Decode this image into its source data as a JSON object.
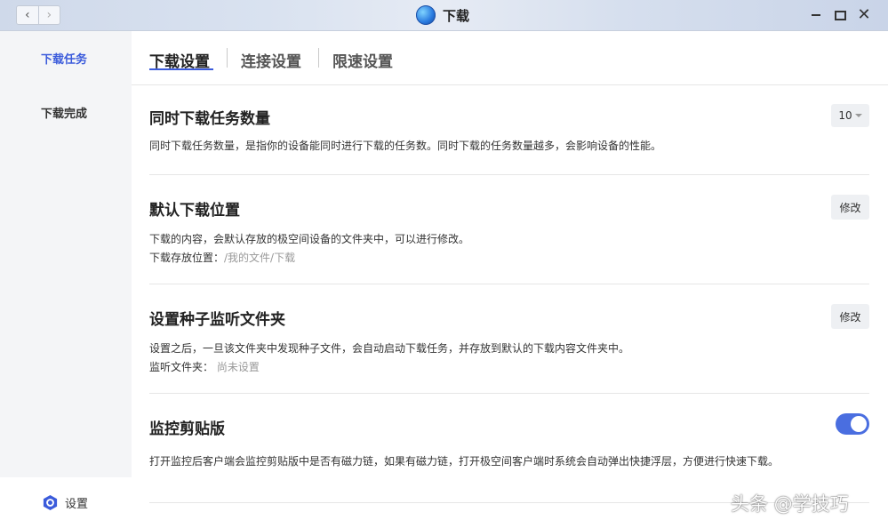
{
  "window": {
    "title": "下载"
  },
  "sidebar": {
    "items": [
      {
        "label": "下载任务",
        "active": true
      },
      {
        "label": "下载完成",
        "active": false
      }
    ],
    "settings_label": "设置"
  },
  "tabs": [
    {
      "label": "下载设置",
      "active": true
    },
    {
      "label": "连接设置",
      "active": false
    },
    {
      "label": "限速设置",
      "active": false
    }
  ],
  "sections": {
    "concurrent": {
      "title": "同时下载任务数量",
      "description": "同时下载任务数量，是指你的设备能同时进行下载的任务数。同时下载的任务数量越多，会影响设备的性能。",
      "select_value": "10"
    },
    "location": {
      "title": "默认下载位置",
      "description": "下载的内容，会默认存放的极空间设备的文件夹中，可以进行修改。",
      "path_label": "下载存放位置：",
      "path_value": "/我的文件/下载",
      "button_label": "修改"
    },
    "torrent": {
      "title": "设置种子监听文件夹",
      "description": "设置之后，一旦该文件夹中发现种子文件，会自动启动下载任务，并存放到默认的下载内容文件夹中。",
      "folder_label": "监听文件夹：",
      "folder_value": "尚未设置",
      "button_label": "修改"
    },
    "clipboard": {
      "title": "监控剪贴版",
      "description": "打开监控后客户端会监控剪贴版中是否有磁力链，如果有磁力链，打开极空间客户端时系统会自动弹出快捷浮层，方便进行快速下载。",
      "enabled": true
    }
  },
  "watermark": "头条 @学技巧",
  "colors": {
    "accent": "#3b5bdb",
    "toggle_on": "#4a6ee0"
  }
}
